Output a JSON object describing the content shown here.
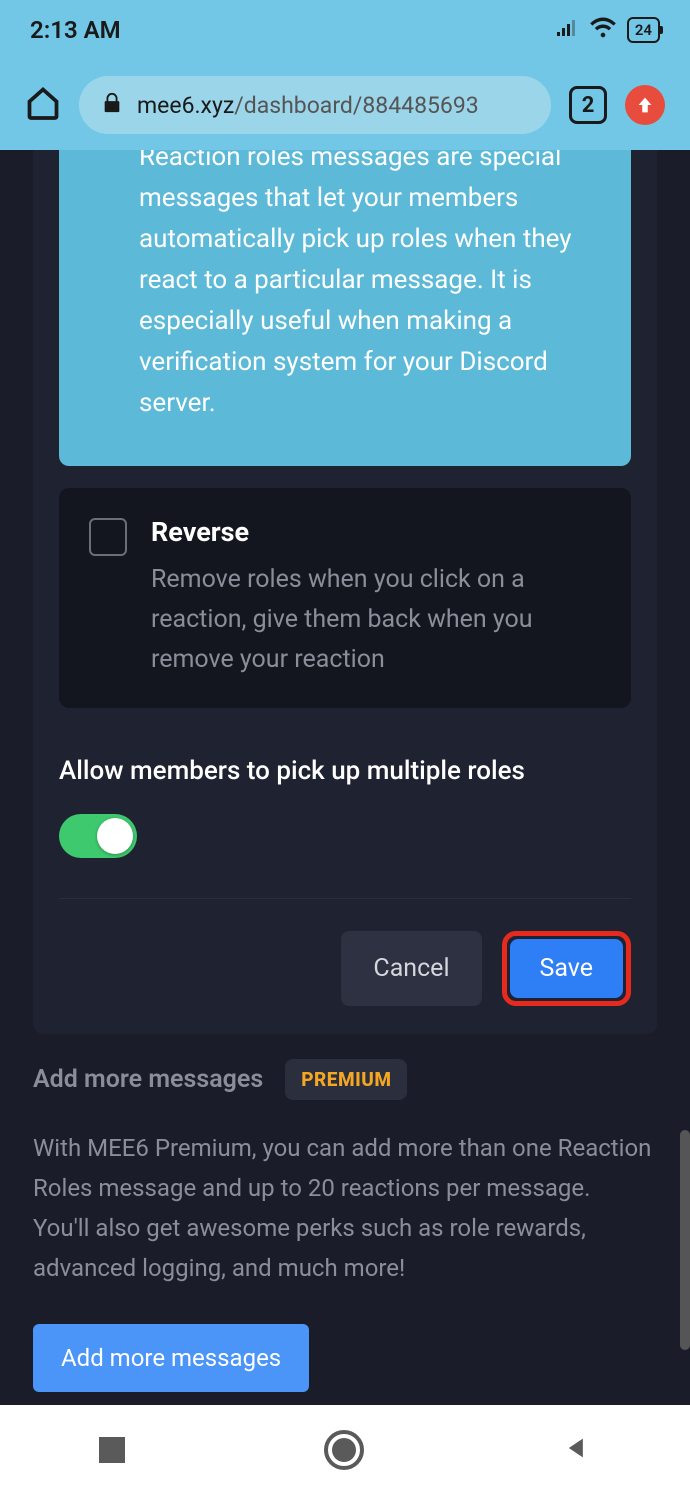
{
  "status": {
    "time": "2:13 AM",
    "battery": "24"
  },
  "browser": {
    "url_domain": "mee6.xyz",
    "url_path": "/dashboard/884485693",
    "tab_count": "2"
  },
  "info": {
    "description": "Reaction roles messages are special messages that let your members automatically pick up roles when they react to a particular message. It is especially useful when making a verification system for your Discord server."
  },
  "reverse": {
    "title": "Reverse",
    "description": "Remove roles when you click on a reaction, give them back when you remove your reaction"
  },
  "allow": {
    "label": "Allow members to pick up multiple roles"
  },
  "buttons": {
    "cancel": "Cancel",
    "save": "Save",
    "add_more": "Add more messages"
  },
  "premium": {
    "title": "Add more messages",
    "badge": "PREMIUM",
    "description": "With MEE6 Premium, you can add more than one Reaction Roles message and up to 20 reactions per message.\nYou'll also get awesome perks such as role rewards, advanced logging, and much more!"
  }
}
